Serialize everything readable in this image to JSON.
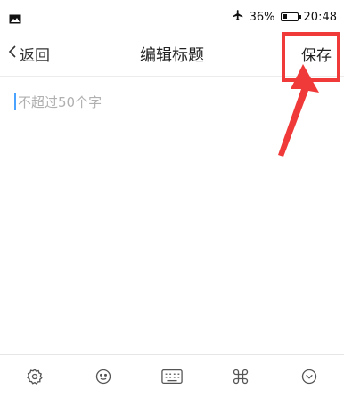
{
  "status_bar": {
    "battery_percent": "36%",
    "battery_level": 0.36,
    "time": "20:48",
    "icons": [
      "image-icon",
      "airplane-icon",
      "battery-icon"
    ]
  },
  "nav": {
    "back_label": "返回",
    "title": "编辑标题",
    "save_label": "保存"
  },
  "editor": {
    "placeholder": "不超过50个字",
    "value": ""
  },
  "toolbar": {
    "items": [
      "settings-icon",
      "emoji-icon",
      "keyboard-icon",
      "command-icon",
      "collapse-icon"
    ]
  },
  "annotation": {
    "color": "#f03a3a"
  }
}
